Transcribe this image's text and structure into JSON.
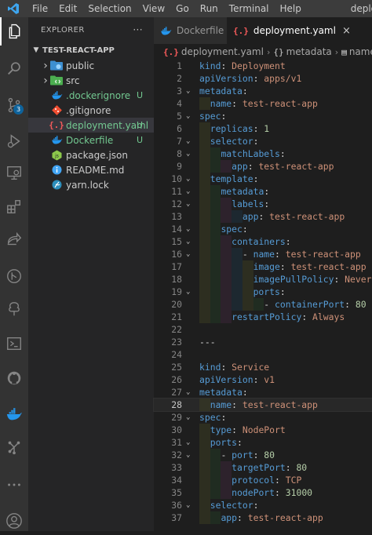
{
  "titlebar": {
    "menus": [
      "File",
      "Edit",
      "Selection",
      "View",
      "Go",
      "Run",
      "Terminal",
      "Help"
    ],
    "window_title": "deplo"
  },
  "activity_bar": {
    "items": [
      {
        "icon": "files-icon",
        "active": true
      },
      {
        "icon": "search-icon"
      },
      {
        "icon": "source-control-icon",
        "badge": "3"
      },
      {
        "icon": "run-debug-icon"
      },
      {
        "icon": "remote-explorer-icon"
      },
      {
        "icon": "extensions-icon"
      },
      {
        "icon": "live-share-icon"
      },
      {
        "icon": "git-graph-icon"
      },
      {
        "icon": "tree-icon"
      },
      {
        "icon": "terminal-icon"
      },
      {
        "icon": "github-icon"
      },
      {
        "icon": "docker-icon"
      },
      {
        "icon": "kubernetes-icon"
      },
      {
        "icon": "more-icon"
      },
      {
        "icon": "account-icon"
      }
    ]
  },
  "sidebar": {
    "header": "EXPLORER",
    "more": "···",
    "folder": "TEST-REACT-APP",
    "items": [
      {
        "label": "public",
        "type": "folder",
        "icon": "folder-public-icon"
      },
      {
        "label": "src",
        "type": "folder",
        "icon": "folder-src-icon"
      },
      {
        "label": ".dockerignore",
        "icon": "docker-icon",
        "status": "U"
      },
      {
        "label": ".gitignore",
        "icon": "git-icon"
      },
      {
        "label": "deployment.yaml",
        "icon": "yaml-icon",
        "status": "U",
        "selected": true
      },
      {
        "label": "Dockerfile",
        "icon": "docker-icon",
        "status": "U"
      },
      {
        "label": "package.json",
        "icon": "nodejs-icon"
      },
      {
        "label": "README.md",
        "icon": "info-icon"
      },
      {
        "label": "yarn.lock",
        "icon": "yarn-icon"
      }
    ]
  },
  "tabs": [
    {
      "label": "Dockerfile",
      "icon": "docker-icon",
      "active": false
    },
    {
      "label": "deployment.yaml",
      "icon": "yaml-icon",
      "active": true,
      "close": "×"
    }
  ],
  "breadcrumb": [
    "deployment.yaml",
    "metadata",
    "name"
  ],
  "code": [
    {
      "n": "1",
      "t": "kind: Deployment"
    },
    {
      "n": "2",
      "t": "apiVersion: apps/v1"
    },
    {
      "n": "3",
      "t": "metadata:",
      "fold": true
    },
    {
      "n": "4",
      "t": "  name: test-react-app"
    },
    {
      "n": "5",
      "t": "spec:",
      "fold": true
    },
    {
      "n": "6",
      "t": "  replicas: 1"
    },
    {
      "n": "7",
      "t": "  selector:",
      "fold": true
    },
    {
      "n": "8",
      "t": "    matchLabels:",
      "fold": true
    },
    {
      "n": "9",
      "t": "      app: test-react-app"
    },
    {
      "n": "10",
      "t": "  template:",
      "fold": true
    },
    {
      "n": "11",
      "t": "    metadata:",
      "fold": true
    },
    {
      "n": "12",
      "t": "      labels:",
      "fold": true
    },
    {
      "n": "13",
      "t": "        app: test-react-app"
    },
    {
      "n": "14",
      "t": "    spec:",
      "fold": true
    },
    {
      "n": "15",
      "t": "      containers:",
      "fold": true
    },
    {
      "n": "16",
      "t": "        - name: test-react-app",
      "fold": true
    },
    {
      "n": "17",
      "t": "          image: test-react-app"
    },
    {
      "n": "18",
      "t": "          imagePullPolicy: Never"
    },
    {
      "n": "19",
      "t": "          ports:",
      "fold": true
    },
    {
      "n": "20",
      "t": "            - containerPort: 80"
    },
    {
      "n": "21",
      "t": "      restartPolicy: Always"
    },
    {
      "n": "22",
      "t": ""
    },
    {
      "n": "23",
      "t": "---"
    },
    {
      "n": "24",
      "t": ""
    },
    {
      "n": "25",
      "t": "kind: Service"
    },
    {
      "n": "26",
      "t": "apiVersion: v1"
    },
    {
      "n": "27",
      "t": "metadata:",
      "fold": true
    },
    {
      "n": "28",
      "t": "  name: test-react-app",
      "current": true
    },
    {
      "n": "29",
      "t": "spec:",
      "fold": true
    },
    {
      "n": "30",
      "t": "  type: NodePort"
    },
    {
      "n": "31",
      "t": "  ports:",
      "fold": true
    },
    {
      "n": "32",
      "t": "    - port: 80",
      "fold": true
    },
    {
      "n": "33",
      "t": "      targetPort: 80"
    },
    {
      "n": "34",
      "t": "      protocol: TCP"
    },
    {
      "n": "35",
      "t": "      nodePort: 31000"
    },
    {
      "n": "36",
      "t": "  selector:",
      "fold": true
    },
    {
      "n": "37",
      "t": "    app: test-react-app"
    }
  ],
  "colors": {
    "key": "#569cd6",
    "string": "#ce9178",
    "number": "#b5cea8",
    "untracked": "#73c991",
    "indent_guides": [
      "#3a3d22",
      "#233824",
      "#3a2638",
      "#1e3140"
    ]
  }
}
